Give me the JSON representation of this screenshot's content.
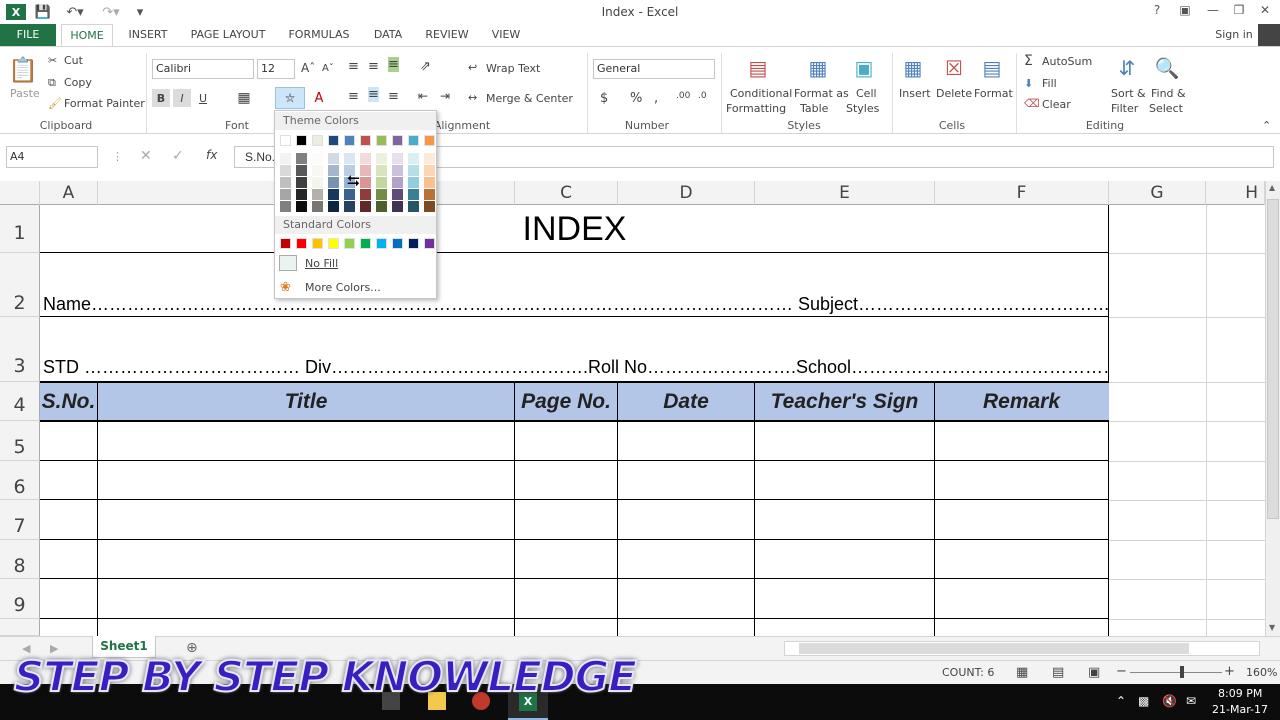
{
  "window": {
    "title": "Index - Excel",
    "signin": "Sign in"
  },
  "tabs": [
    "FILE",
    "HOME",
    "INSERT",
    "PAGE LAYOUT",
    "FORMULAS",
    "DATA",
    "REVIEW",
    "VIEW"
  ],
  "clipboard": {
    "paste": "Paste",
    "cut": "Cut",
    "copy": "Copy",
    "format_painter": "Format Painter",
    "label": "Clipboard"
  },
  "font": {
    "name": "Calibri",
    "size": "12",
    "label": "Font",
    "bold": "B",
    "italic": "I",
    "underline": "U"
  },
  "alignment": {
    "wrap": "Wrap Text",
    "merge": "Merge & Center",
    "label": "Alignment"
  },
  "number": {
    "format": "General",
    "label": "Number",
    "currency": "$",
    "percent": "%",
    "comma": ","
  },
  "styles": {
    "conditional": "Conditional",
    "conditional2": "Formatting",
    "format_as": "Format as",
    "table": "Table",
    "cell": "Cell",
    "styles": "Styles",
    "label": "Styles"
  },
  "cells": {
    "insert": "Insert",
    "delete": "Delete",
    "format": "Format",
    "label": "Cells"
  },
  "editing": {
    "autosum": "AutoSum",
    "fill": "Fill",
    "clear": "Clear",
    "sort": "Sort &",
    "filter": "Filter",
    "find": "Find &",
    "select": "Select",
    "label": "Editing"
  },
  "formula_bar": {
    "name_box": "A4",
    "content": "S.No.",
    "fx": "fx"
  },
  "columns": [
    "A",
    "B",
    "C",
    "D",
    "E",
    "F",
    "G",
    "H"
  ],
  "rows": [
    "1",
    "2",
    "3",
    "4",
    "5",
    "6",
    "7",
    "8",
    "9"
  ],
  "sheet": {
    "title": "INDEX",
    "row2": "Name……………………………………………………………………………………………………… Subject……………………………………………………………",
    "row3": "STD ……………………………… Div…………………………………….Roll No…………………….School…………………………………………………………",
    "headers": [
      "S.No.",
      "Title",
      "Page No.",
      "Date",
      "Teacher's Sign",
      "Remark"
    ]
  },
  "dropdown": {
    "theme_title": "Theme Colors",
    "standard_title": "Standard Colors",
    "no_fill": "No Fill",
    "more_colors": "More Colors...",
    "theme_colors": [
      "#ffffff",
      "#000000",
      "#eeece1",
      "#1f497d",
      "#4f81bd",
      "#c0504d",
      "#9bbb59",
      "#8064a2",
      "#4bacc6",
      "#f79646"
    ],
    "standard_colors": [
      "#c00000",
      "#ff0000",
      "#ffc000",
      "#ffff00",
      "#92d050",
      "#00b050",
      "#00b0f0",
      "#0070c0",
      "#002060",
      "#7030a0"
    ]
  },
  "sheet_tab": "Sheet1",
  "status": {
    "count": "COUNT: 6",
    "zoom": "160%"
  },
  "taskbar": {
    "time": "8:09 PM",
    "date": "21-Mar-17"
  },
  "watermark": "STEP BY STEP KNOWLEDGE"
}
